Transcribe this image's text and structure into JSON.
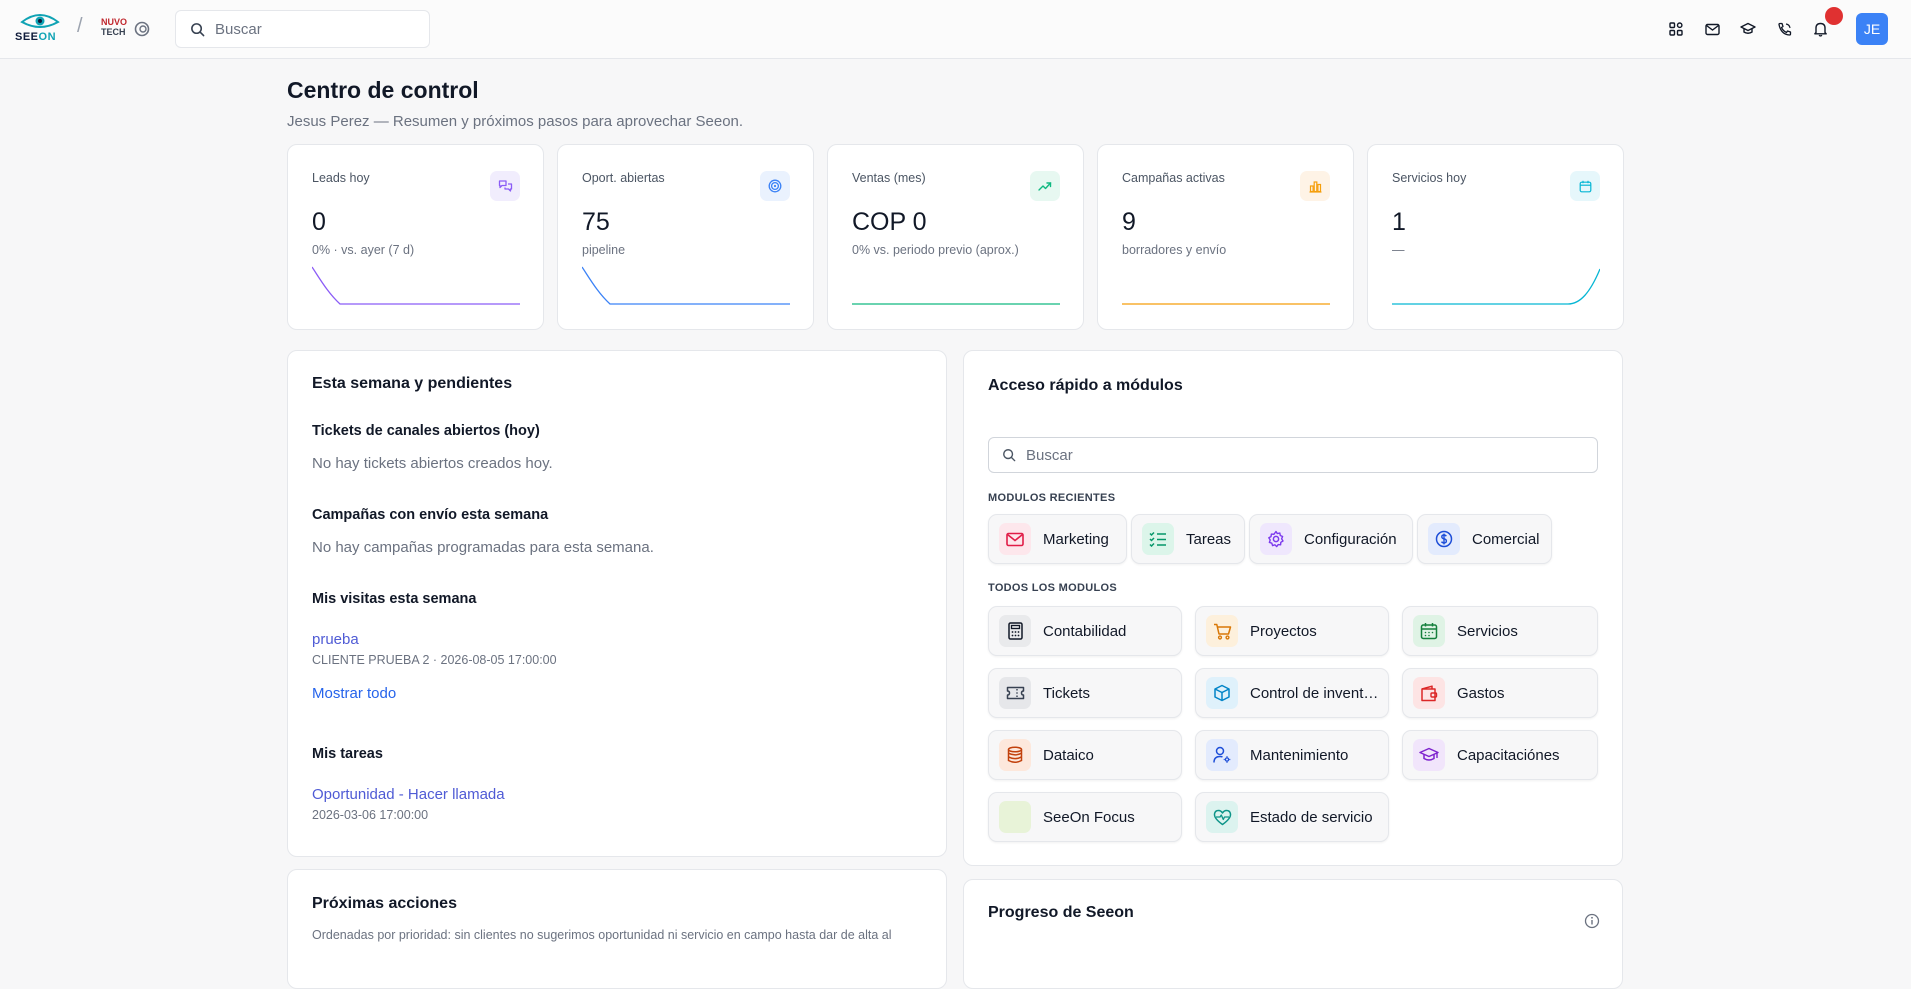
{
  "topbar": {
    "brand": "SEE",
    "brand_accent": "ON",
    "partner_line1": "NUVO",
    "partner_line2": "TECH",
    "search_placeholder": "Buscar",
    "avatar_initials": "JE",
    "icons": [
      "apps-icon",
      "mail-icon",
      "graduation-cap-icon",
      "phone-icon",
      "bell-icon"
    ]
  },
  "header": {
    "title": "Centro de control",
    "subtitle": "Jesus Perez — Resumen y próximos pasos para aprovechar Seeon."
  },
  "kpis": [
    {
      "label": "Leads hoy",
      "value": "0",
      "sub": "0% · vs. ayer (7 d)",
      "color": "#8b5cf6",
      "bg": "#f1edfd",
      "icon": "chat-arrows-icon"
    },
    {
      "label": "Oport. abiertas",
      "value": "75",
      "sub": "pipeline",
      "color": "#3b82f6",
      "bg": "#eaf2fe",
      "icon": "target-icon"
    },
    {
      "label": "Ventas (mes)",
      "value": "COP 0",
      "sub": "0% vs. periodo previo (aprox.)",
      "color": "#10b981",
      "bg": "#e7f8f1",
      "icon": "trend-up-icon"
    },
    {
      "label": "Campañas activas",
      "value": "9",
      "sub": "borradores y envío",
      "color": "#f59e0b",
      "bg": "#fef3e6",
      "icon": "bar-chart-icon"
    },
    {
      "label": "Servicios hoy",
      "value": "1",
      "sub": "—",
      "color": "#06b6d4",
      "bg": "#e6f7fb",
      "icon": "calendar-icon"
    }
  ],
  "week": {
    "title": "Esta semana y pendientes",
    "tickets_title": "Tickets de canales abiertos (hoy)",
    "tickets_empty": "No hay tickets abiertos creados hoy.",
    "campaigns_title": "Campañas con envío esta semana",
    "campaigns_empty": "No hay campañas programadas para esta semana.",
    "visits_title": "Mis visitas esta semana",
    "visit_name": "prueba",
    "visit_meta": "CLIENTE PRUEBA 2 · 2026-08-05 17:00:00",
    "show_all": "Mostrar todo",
    "tasks_title": "Mis tareas",
    "task_name": "Oportunidad - Hacer llamada",
    "task_meta": "2026-03-06 17:00:00"
  },
  "quick": {
    "title": "Acceso rápido a módulos",
    "search_placeholder": "Buscar",
    "recent_label": "MODULOS RECIENTES",
    "all_label": "TODOS LOS MODULOS",
    "recent": [
      {
        "name": "Marketing",
        "icon": "mail-icon",
        "color": "#e11d48",
        "bg": "#fde7ec"
      },
      {
        "name": "Tareas",
        "icon": "checklist-icon",
        "color": "#059669",
        "bg": "#dcf5ea"
      },
      {
        "name": "Configuración",
        "icon": "gear-icon",
        "color": "#7c3aed",
        "bg": "#efe7fd"
      },
      {
        "name": "Comercial",
        "icon": "dollar-icon",
        "color": "#1d4ed8",
        "bg": "#e3ebfd"
      }
    ],
    "all": [
      {
        "name": "Contabilidad",
        "icon": "calculator-icon",
        "color": "#111827",
        "bg": "#e9eaec"
      },
      {
        "name": "Proyectos",
        "icon": "cart-icon",
        "color": "#d97706",
        "bg": "#fdf0dc"
      },
      {
        "name": "Servicios",
        "icon": "calendar-icon",
        "color": "#15803d",
        "bg": "#dff3e5"
      },
      {
        "name": "Tickets",
        "icon": "ticket-icon",
        "color": "#374151",
        "bg": "#e6e7ea"
      },
      {
        "name": "Control de inventario",
        "icon": "box-icon",
        "color": "#0284c7",
        "bg": "#dff1fb"
      },
      {
        "name": "Gastos",
        "icon": "wallet-icon",
        "color": "#dc2626",
        "bg": "#fde4e4"
      },
      {
        "name": "Dataico",
        "icon": "database-icon",
        "color": "#c2410c",
        "bg": "#fde8dc"
      },
      {
        "name": "Mantenimiento",
        "icon": "user-gear-icon",
        "color": "#1d4ed8",
        "bg": "#e3ebfd"
      },
      {
        "name": "Capacitaciónes",
        "icon": "graduation-cap-icon",
        "color": "#7e22ce",
        "bg": "#f1e5fb"
      },
      {
        "name": "SeeOn Focus",
        "icon": "blank-icon",
        "color": "#84cc16",
        "bg": "#e8f3d8"
      },
      {
        "name": "Estado de servicio",
        "icon": "heart-pulse-icon",
        "color": "#0d9488",
        "bg": "#dcf3ef"
      }
    ]
  },
  "next_actions": {
    "title": "Próximas acciones",
    "desc": "Ordenadas por prioridad: sin clientes no sugerimos oportunidad ni servicio en campo hasta dar de alta al"
  },
  "progress": {
    "title": "Progreso de Seeon"
  }
}
